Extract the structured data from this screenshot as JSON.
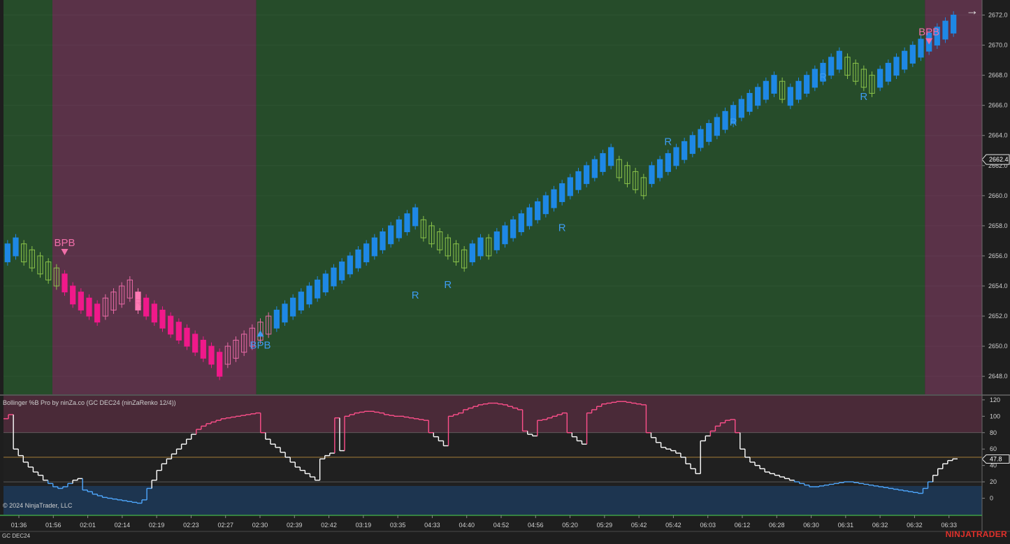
{
  "price_panel": {
    "y_ticks": [
      "2672.0",
      "2670.0",
      "2668.0",
      "2666.0",
      "2664.0",
      "2662.0",
      "2660.0",
      "2658.0",
      "2656.0",
      "2654.0",
      "2652.0",
      "2650.0",
      "2648.0"
    ],
    "last_price": "2662.4",
    "regions": [
      {
        "trend": "bull",
        "from_bar": 0,
        "to_bar": 6
      },
      {
        "trend": "bear",
        "from_bar": 6,
        "to_bar": 31
      },
      {
        "trend": "bull",
        "from_bar": 31,
        "to_bar": 113
      },
      {
        "trend": "bear",
        "from_bar": 113,
        "to_bar": 140
      }
    ],
    "colors": {
      "bull_bg": "#264c2a",
      "bear_bg": "#5a3248",
      "bull_strong": "#1e88e5",
      "bull_pullback": "#8bc34a",
      "bull_highlight": "#90ee90",
      "bear_strong": "#f0198a",
      "bear_pullback": "#e86aa6",
      "bear_highlight": "#ff7bb5"
    },
    "annotations": [
      {
        "text": "BPB",
        "bar": 7,
        "price": 2656.0,
        "dir": "down",
        "side": "bear"
      },
      {
        "text": "R",
        "bar": 16,
        "price": 2653.4,
        "dir": "none",
        "side": "bear"
      },
      {
        "text": "BPB",
        "bar": 31,
        "price": 2651.1,
        "dir": "up",
        "side": "bull"
      },
      {
        "text": "R",
        "bar": 50,
        "price": 2653.9,
        "dir": "none",
        "side": "bull"
      },
      {
        "text": "R",
        "bar": 54,
        "price": 2654.6,
        "dir": "none",
        "side": "bull"
      },
      {
        "text": "R",
        "bar": 68,
        "price": 2658.4,
        "dir": "none",
        "side": "bull"
      },
      {
        "text": "R",
        "bar": 81,
        "price": 2664.1,
        "dir": "none",
        "side": "bull"
      },
      {
        "text": "R",
        "bar": 89,
        "price": 2665.4,
        "dir": "none",
        "side": "bull"
      },
      {
        "text": "R",
        "bar": 100,
        "price": 2668.4,
        "dir": "none",
        "side": "bull"
      },
      {
        "text": "R",
        "bar": 105,
        "price": 2667.1,
        "dir": "none",
        "side": "bull"
      },
      {
        "text": "BPB",
        "bar": 113,
        "price": 2670.0,
        "dir": "down",
        "side": "bear"
      },
      {
        "text": "R",
        "bar": 137,
        "price": 2663.0,
        "dir": "none",
        "side": "bear"
      }
    ]
  },
  "chart_data": [
    {
      "type": "candlestick",
      "title": "",
      "instrument": "GC DEC24",
      "bar_type": "ninZaRenko 12/4",
      "ylim": [
        2646.8,
        2673.0
      ],
      "brick_size": 0.4,
      "x_tick_labels": [
        "01:36",
        "01:56",
        "02:01",
        "02:14",
        "02:19",
        "02:23",
        "02:27",
        "02:30",
        "02:39",
        "02:42",
        "03:19",
        "03:35",
        "04:33",
        "04:40",
        "04:52",
        "04:56",
        "05:20",
        "05:29",
        "05:42",
        "05:42",
        "06:03",
        "06:12",
        "06:28",
        "06:30",
        "06:31",
        "06:32",
        "06:32",
        "06:33"
      ],
      "bricks": [
        {
          "o": 2655.6,
          "c": 2656.8,
          "style": "bull_strong"
        },
        {
          "o": 2656.0,
          "c": 2657.2,
          "style": "bull_strong"
        },
        {
          "o": 2656.8,
          "c": 2655.6,
          "style": "bull_pullback"
        },
        {
          "o": 2656.4,
          "c": 2655.2,
          "style": "bull_pullback"
        },
        {
          "o": 2656.0,
          "c": 2654.8,
          "style": "bull_pullback"
        },
        {
          "o": 2655.6,
          "c": 2654.4,
          "style": "bull_pullback"
        },
        {
          "o": 2655.2,
          "c": 2654.0,
          "style": "bull_pullback"
        },
        {
          "o": 2654.8,
          "c": 2653.6,
          "style": "bear_strong"
        },
        {
          "o": 2654.0,
          "c": 2652.8,
          "style": "bear_strong"
        },
        {
          "o": 2653.6,
          "c": 2652.4,
          "style": "bear_strong"
        },
        {
          "o": 2653.2,
          "c": 2652.0,
          "style": "bear_strong"
        },
        {
          "o": 2652.8,
          "c": 2651.6,
          "style": "bear_strong"
        },
        {
          "o": 2652.0,
          "c": 2653.2,
          "style": "bear_pullback"
        },
        {
          "o": 2652.4,
          "c": 2653.6,
          "style": "bear_pullback"
        },
        {
          "o": 2652.8,
          "c": 2654.0,
          "style": "bear_pullback"
        },
        {
          "o": 2653.2,
          "c": 2654.4,
          "style": "bear_pullback"
        },
        {
          "o": 2653.6,
          "c": 2652.4,
          "style": "bear_highlight"
        },
        {
          "o": 2653.2,
          "c": 2652.0,
          "style": "bear_strong"
        },
        {
          "o": 2652.8,
          "c": 2651.6,
          "style": "bear_strong"
        },
        {
          "o": 2652.4,
          "c": 2651.2,
          "style": "bear_strong"
        },
        {
          "o": 2652.0,
          "c": 2650.8,
          "style": "bear_strong"
        },
        {
          "o": 2651.6,
          "c": 2650.4,
          "style": "bear_strong"
        },
        {
          "o": 2651.2,
          "c": 2650.0,
          "style": "bear_strong"
        },
        {
          "o": 2650.8,
          "c": 2649.6,
          "style": "bear_strong"
        },
        {
          "o": 2650.4,
          "c": 2649.2,
          "style": "bear_strong"
        },
        {
          "o": 2650.0,
          "c": 2648.8,
          "style": "bear_strong"
        },
        {
          "o": 2649.6,
          "c": 2648.0,
          "style": "bear_strong"
        },
        {
          "o": 2648.8,
          "c": 2650.0,
          "style": "bear_pullback"
        },
        {
          "o": 2649.2,
          "c": 2650.4,
          "style": "bear_pullback"
        },
        {
          "o": 2649.6,
          "c": 2650.8,
          "style": "bear_pullback"
        },
        {
          "o": 2650.0,
          "c": 2651.2,
          "style": "bear_pullback"
        },
        {
          "o": 2650.4,
          "c": 2651.6,
          "style": "bear_pullback"
        },
        {
          "o": 2650.8,
          "c": 2652.0,
          "style": "bear_pullback"
        },
        {
          "o": 2651.2,
          "c": 2652.4,
          "style": "bull_strong"
        },
        {
          "o": 2651.6,
          "c": 2652.8,
          "style": "bull_strong"
        },
        {
          "o": 2652.0,
          "c": 2653.2,
          "style": "bull_strong"
        },
        {
          "o": 2652.4,
          "c": 2653.6,
          "style": "bull_strong"
        },
        {
          "o": 2652.8,
          "c": 2654.0,
          "style": "bull_strong"
        },
        {
          "o": 2653.2,
          "c": 2654.4,
          "style": "bull_strong"
        },
        {
          "o": 2653.6,
          "c": 2654.8,
          "style": "bull_strong"
        },
        {
          "o": 2654.0,
          "c": 2655.2,
          "style": "bull_strong"
        },
        {
          "o": 2654.4,
          "c": 2655.6,
          "style": "bull_strong"
        },
        {
          "o": 2654.8,
          "c": 2656.0,
          "style": "bull_strong"
        },
        {
          "o": 2655.2,
          "c": 2656.4,
          "style": "bull_strong"
        },
        {
          "o": 2655.6,
          "c": 2656.8,
          "style": "bull_strong"
        },
        {
          "o": 2656.0,
          "c": 2657.2,
          "style": "bull_strong"
        },
        {
          "o": 2656.4,
          "c": 2657.6,
          "style": "bull_strong"
        },
        {
          "o": 2656.8,
          "c": 2658.0,
          "style": "bull_strong"
        },
        {
          "o": 2657.2,
          "c": 2658.4,
          "style": "bull_strong"
        },
        {
          "o": 2657.6,
          "c": 2658.8,
          "style": "bull_strong"
        },
        {
          "o": 2658.0,
          "c": 2659.2,
          "style": "bull_strong"
        },
        {
          "o": 2658.4,
          "c": 2657.2,
          "style": "bull_pullback"
        },
        {
          "o": 2658.0,
          "c": 2656.8,
          "style": "bull_pullback"
        },
        {
          "o": 2657.6,
          "c": 2656.4,
          "style": "bull_pullback"
        },
        {
          "o": 2657.2,
          "c": 2656.0,
          "style": "bull_pullback"
        },
        {
          "o": 2656.8,
          "c": 2655.6,
          "style": "bull_pullback"
        },
        {
          "o": 2656.4,
          "c": 2655.2,
          "style": "bull_pullback"
        },
        {
          "o": 2655.6,
          "c": 2656.8,
          "style": "bull_strong"
        },
        {
          "o": 2656.0,
          "c": 2657.2,
          "style": "bull_strong"
        },
        {
          "o": 2657.2,
          "c": 2656.0,
          "style": "bull_pullback"
        },
        {
          "o": 2656.4,
          "c": 2657.6,
          "style": "bull_strong"
        },
        {
          "o": 2656.8,
          "c": 2658.0,
          "style": "bull_strong"
        },
        {
          "o": 2657.2,
          "c": 2658.4,
          "style": "bull_strong"
        },
        {
          "o": 2657.6,
          "c": 2658.8,
          "style": "bull_strong"
        },
        {
          "o": 2658.0,
          "c": 2659.2,
          "style": "bull_strong"
        },
        {
          "o": 2658.4,
          "c": 2659.6,
          "style": "bull_strong"
        },
        {
          "o": 2658.8,
          "c": 2660.0,
          "style": "bull_strong"
        },
        {
          "o": 2659.2,
          "c": 2660.4,
          "style": "bull_strong"
        },
        {
          "o": 2659.6,
          "c": 2660.8,
          "style": "bull_strong"
        },
        {
          "o": 2660.0,
          "c": 2661.2,
          "style": "bull_strong"
        },
        {
          "o": 2660.4,
          "c": 2661.6,
          "style": "bull_strong"
        },
        {
          "o": 2660.8,
          "c": 2662.0,
          "style": "bull_strong"
        },
        {
          "o": 2661.2,
          "c": 2662.4,
          "style": "bull_strong"
        },
        {
          "o": 2661.6,
          "c": 2662.8,
          "style": "bull_strong"
        },
        {
          "o": 2662.0,
          "c": 2663.2,
          "style": "bull_strong"
        },
        {
          "o": 2662.4,
          "c": 2661.2,
          "style": "bull_pullback"
        },
        {
          "o": 2662.0,
          "c": 2660.8,
          "style": "bull_pullback"
        },
        {
          "o": 2661.6,
          "c": 2660.4,
          "style": "bull_pullback"
        },
        {
          "o": 2661.2,
          "c": 2660.0,
          "style": "bull_pullback"
        },
        {
          "o": 2660.8,
          "c": 2662.0,
          "style": "bull_strong"
        },
        {
          "o": 2661.2,
          "c": 2662.4,
          "style": "bull_strong"
        },
        {
          "o": 2661.6,
          "c": 2662.8,
          "style": "bull_strong"
        },
        {
          "o": 2662.0,
          "c": 2663.2,
          "style": "bull_strong"
        },
        {
          "o": 2662.4,
          "c": 2663.6,
          "style": "bull_strong"
        },
        {
          "o": 2662.8,
          "c": 2664.0,
          "style": "bull_strong"
        },
        {
          "o": 2663.2,
          "c": 2664.4,
          "style": "bull_strong"
        },
        {
          "o": 2663.6,
          "c": 2664.8,
          "style": "bull_strong"
        },
        {
          "o": 2664.0,
          "c": 2665.2,
          "style": "bull_strong"
        },
        {
          "o": 2664.4,
          "c": 2665.6,
          "style": "bull_strong"
        },
        {
          "o": 2664.8,
          "c": 2666.0,
          "style": "bull_strong"
        },
        {
          "o": 2665.2,
          "c": 2666.4,
          "style": "bull_strong"
        },
        {
          "o": 2665.6,
          "c": 2666.8,
          "style": "bull_strong"
        },
        {
          "o": 2666.0,
          "c": 2667.2,
          "style": "bull_strong"
        },
        {
          "o": 2666.4,
          "c": 2667.6,
          "style": "bull_strong"
        },
        {
          "o": 2666.8,
          "c": 2668.0,
          "style": "bull_strong"
        },
        {
          "o": 2667.6,
          "c": 2666.4,
          "style": "bull_pullback"
        },
        {
          "o": 2666.0,
          "c": 2667.2,
          "style": "bull_strong"
        },
        {
          "o": 2666.4,
          "c": 2667.6,
          "style": "bull_strong"
        },
        {
          "o": 2666.8,
          "c": 2668.0,
          "style": "bull_strong"
        },
        {
          "o": 2667.2,
          "c": 2668.4,
          "style": "bull_strong"
        },
        {
          "o": 2667.6,
          "c": 2668.8,
          "style": "bull_strong"
        },
        {
          "o": 2668.0,
          "c": 2669.2,
          "style": "bull_strong"
        },
        {
          "o": 2668.4,
          "c": 2669.6,
          "style": "bull_strong"
        },
        {
          "o": 2669.2,
          "c": 2668.0,
          "style": "bull_pullback"
        },
        {
          "o": 2668.8,
          "c": 2667.6,
          "style": "bull_pullback"
        },
        {
          "o": 2668.4,
          "c": 2667.2,
          "style": "bull_pullback"
        },
        {
          "o": 2668.0,
          "c": 2666.8,
          "style": "bull_pullback"
        },
        {
          "o": 2667.2,
          "c": 2668.4,
          "style": "bull_strong"
        },
        {
          "o": 2667.6,
          "c": 2668.8,
          "style": "bull_strong"
        },
        {
          "o": 2668.0,
          "c": 2669.2,
          "style": "bull_strong"
        },
        {
          "o": 2668.4,
          "c": 2669.6,
          "style": "bull_strong"
        },
        {
          "o": 2668.8,
          "c": 2670.0,
          "style": "bull_strong"
        },
        {
          "o": 2669.2,
          "c": 2670.4,
          "style": "bull_strong"
        },
        {
          "o": 2669.6,
          "c": 2670.8,
          "style": "bull_strong"
        },
        {
          "o": 2670.0,
          "c": 2671.2,
          "style": "bull_strong"
        },
        {
          "o": 2670.4,
          "c": 2671.6,
          "style": "bull_strong"
        },
        {
          "o": 2670.8,
          "c": 2672.0,
          "style": "bull_strong"
        }
      ]
    },
    {
      "type": "line",
      "title": "Bollinger %B Pro by ninZa.co (GC DEC24 (ninZaRenko 12/4))",
      "ylim": [
        -20,
        125
      ],
      "y_ticks": [
        120,
        100,
        80,
        60,
        40,
        20,
        0
      ],
      "last_value": "47.8",
      "upper_level": 80,
      "lower_level": 20,
      "mid_level": 50,
      "series": [
        {
          "values": [
            97,
            102,
            60,
            52,
            44,
            38,
            32,
            28,
            22,
            18,
            14,
            12,
            14,
            18,
            22,
            24,
            10,
            8,
            5,
            3,
            1,
            0,
            -1,
            -2,
            -3,
            -4,
            -5,
            -6,
            -2,
            12,
            22,
            34,
            42,
            48,
            54,
            60,
            66,
            72,
            78,
            84,
            88,
            91,
            93,
            95,
            97,
            98,
            99,
            100,
            101,
            102,
            103,
            104,
            80,
            72,
            66,
            62,
            56,
            50,
            44,
            38,
            34,
            30,
            26,
            22,
            48,
            52,
            55,
            98,
            58,
            100,
            102,
            104,
            105,
            106,
            106,
            105,
            104,
            102,
            101,
            100,
            100,
            99,
            98,
            97,
            96,
            95,
            80,
            75,
            70,
            64,
            100,
            102,
            104,
            108,
            110,
            112,
            114,
            115,
            116,
            116,
            115,
            114,
            112,
            110,
            108,
            82,
            78,
            76,
            95,
            96,
            98,
            100,
            102,
            104,
            80,
            75,
            70,
            66,
            104,
            108,
            112,
            115,
            116,
            117,
            118,
            118,
            117,
            116,
            115,
            114,
            80,
            74,
            68,
            62,
            60,
            58,
            55,
            50,
            42,
            36,
            30,
            70,
            76,
            82,
            88,
            92,
            95,
            96,
            80,
            60,
            50,
            44,
            40,
            36,
            32,
            30,
            28,
            26,
            24,
            22,
            20,
            18,
            16,
            14,
            14,
            15,
            16,
            17,
            18,
            19,
            20,
            20,
            19,
            18,
            17,
            16,
            15,
            14,
            13,
            12,
            11,
            10,
            9,
            8,
            7,
            6,
            12,
            20,
            28,
            36,
            42,
            46,
            48
          ]
        }
      ]
    }
  ],
  "indicator_panel": {
    "title": "Bollinger %B Pro by ninZa.co (GC DEC24 (ninZaRenko 12/4))",
    "copyright": "© 2024 NinjaTrader, LLC",
    "colors": {
      "above": "#ff4f8b",
      "below": "#4fa8ff",
      "neutral": "#ffffff",
      "upper_zone": "#4a2a38",
      "lower_zone": "#1d3550"
    }
  },
  "footer": {
    "instrument": "GC DEC24",
    "brand": "NINJATRADER"
  },
  "toolbar": {
    "nav_icon": "arrow-right-icon",
    "nav_glyph": "→"
  }
}
